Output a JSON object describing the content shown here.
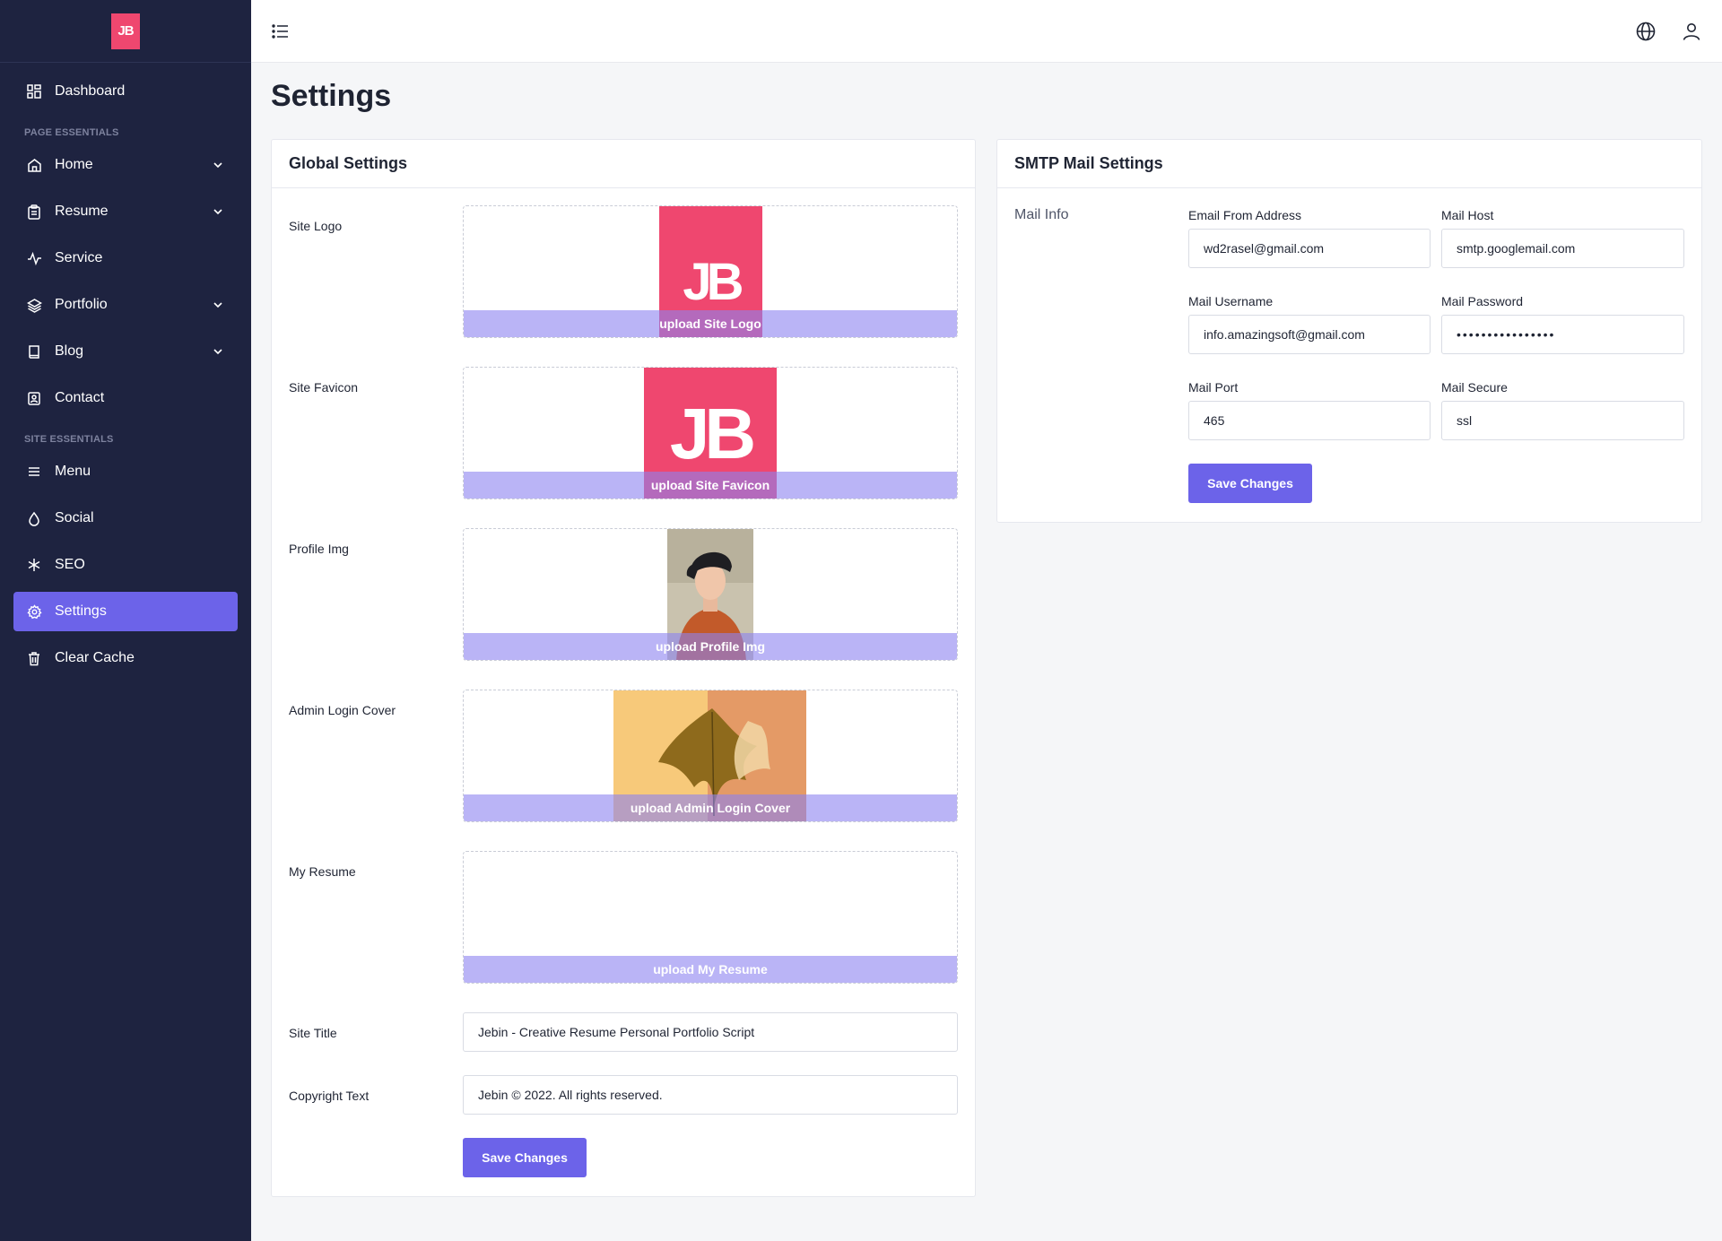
{
  "brand": {
    "logo_text": "JB",
    "color": "#ef476f"
  },
  "sidebar": {
    "dashboard": "Dashboard",
    "section_page": "PAGE ESSENTIALS",
    "home": "Home",
    "resume": "Resume",
    "service": "Service",
    "portfolio": "Portfolio",
    "blog": "Blog",
    "contact": "Contact",
    "section_site": "SITE ESSENTIALS",
    "menu": "Menu",
    "social": "Social",
    "seo": "SEO",
    "settings": "Settings",
    "clear_cache": "Clear Cache",
    "active_color": "#6c63e9"
  },
  "page": {
    "title": "Settings"
  },
  "global": {
    "title": "Global Settings",
    "site_logo_label": "Site Logo",
    "site_logo_upload": "upload Site Logo",
    "site_favicon_label": "Site Favicon",
    "site_favicon_upload": "upload Site Favicon",
    "profile_img_label": "Profile Img",
    "profile_img_upload": "upload Profile Img",
    "admin_cover_label": "Admin Login Cover",
    "admin_cover_upload": "upload Admin Login Cover",
    "resume_label": "My Resume",
    "resume_upload": "upload My Resume",
    "site_title_label": "Site Title",
    "site_title_value": "Jebin - Creative Resume Personal Portfolio Script",
    "copyright_label": "Copyright Text",
    "copyright_value": "Jebin © 2022. All rights reserved.",
    "save_label": "Save Changes"
  },
  "smtp": {
    "title": "SMTP Mail Settings",
    "section_label": "Mail Info",
    "email_from_label": "Email From Address",
    "email_from_value": "wd2rasel@gmail.com",
    "mail_host_label": "Mail Host",
    "mail_host_value": "smtp.googlemail.com",
    "mail_username_label": "Mail Username",
    "mail_username_value": "info.amazingsoft@gmail.com",
    "mail_password_label": "Mail Password",
    "mail_password_value": "••••••••••••••••",
    "mail_port_label": "Mail Port",
    "mail_port_value": "465",
    "mail_secure_label": "Mail Secure",
    "mail_secure_value": "ssl",
    "save_label": "Save Changes"
  },
  "icons": {
    "dashboard": "dashboard-grid-icon",
    "home": "home-icon",
    "resume": "clipboard-icon",
    "service": "activity-icon",
    "portfolio": "layers-icon",
    "blog": "book-icon",
    "contact": "contact-card-icon",
    "menu": "hamburger-icon",
    "social": "droplet-icon",
    "seo": "snowflake-icon",
    "settings": "gear-icon",
    "clear_cache": "trash-icon",
    "top_menu": "list-icon",
    "language": "globe-icon",
    "account": "user-icon"
  }
}
